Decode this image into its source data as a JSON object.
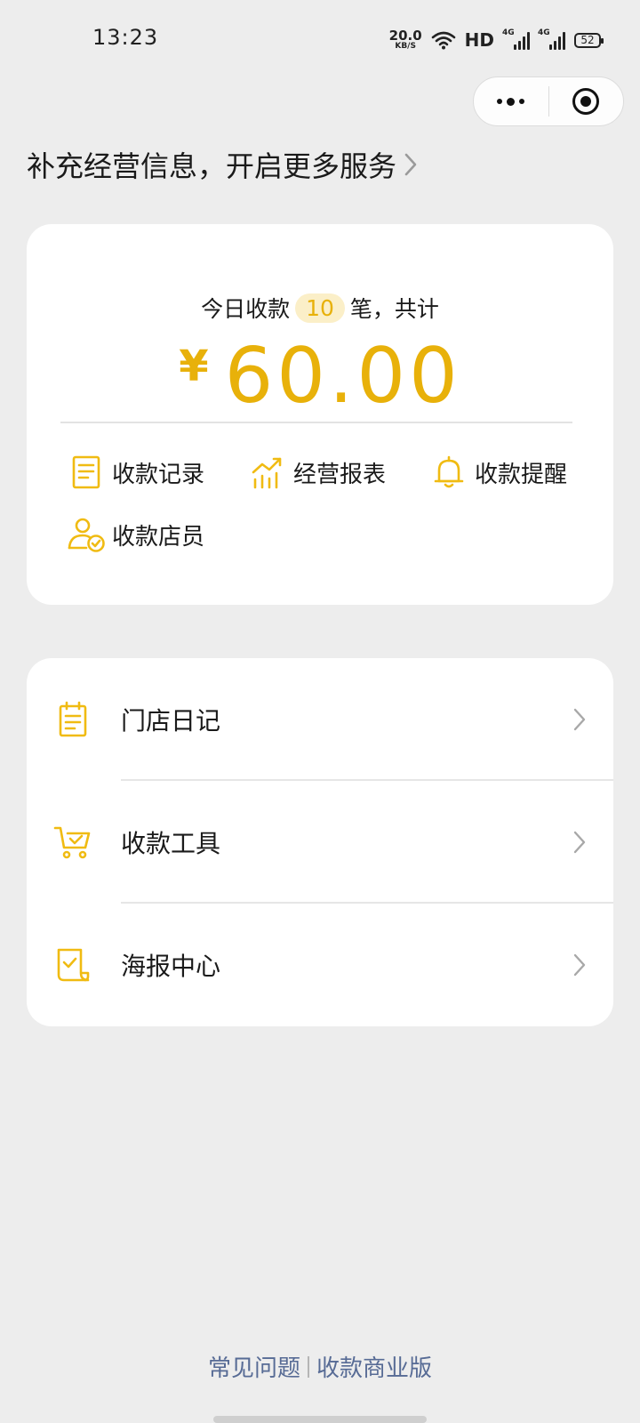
{
  "status_bar": {
    "time": "13:23",
    "net_speed_value": "20.0",
    "net_speed_unit": "KB/S",
    "hd_label": "HD",
    "signal1_label": "4G",
    "signal2_label": "4G",
    "battery_level": "52"
  },
  "banner": {
    "text": "补充经营信息，开启更多服务"
  },
  "summary": {
    "prefix": "今日收款",
    "count": "10",
    "suffix": "笔，共计",
    "currency": "¥",
    "amount": "60.00"
  },
  "shortcuts": [
    {
      "label": "收款记录",
      "icon": "receipt-record-icon"
    },
    {
      "label": "经营报表",
      "icon": "report-chart-icon"
    },
    {
      "label": "收款提醒",
      "icon": "bell-icon"
    },
    {
      "label": "收款店员",
      "icon": "staff-check-icon"
    }
  ],
  "menu": [
    {
      "label": "门店日记",
      "icon": "notepad-icon"
    },
    {
      "label": "收款工具",
      "icon": "cart-check-icon"
    },
    {
      "label": "海报中心",
      "icon": "poster-check-icon"
    }
  ],
  "footer": {
    "faq": "常见问题",
    "business": "收款商业版"
  },
  "colors": {
    "accent": "#e8b10a",
    "link": "#576b95",
    "background": "#ededed"
  }
}
